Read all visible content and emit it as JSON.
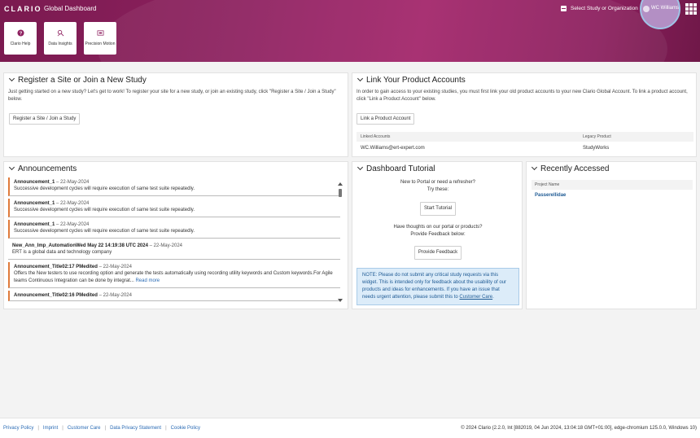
{
  "header": {
    "logo": "CLARIO",
    "title": "Global Dashboard",
    "study_select": "Select Study or Organization",
    "user_name": "WC Williams"
  },
  "tiles": [
    {
      "label": "Clario Help",
      "icon": "help-icon"
    },
    {
      "label": "Data Insights",
      "icon": "data-insights-icon"
    },
    {
      "label": "Precision Motion",
      "icon": "precision-motion-icon"
    }
  ],
  "register": {
    "title": "Register a Site or Join a New Study",
    "text": "Just getting started on a new study? Let's get to work! To register your site for a new study, or join an existing study, click \"Register a Site / Join a Study\" below.",
    "button": "Register a Site / Join a Study"
  },
  "link": {
    "title": "Link Your Product Accounts",
    "text": "In order to gain access to your existing studies, you must first link your old product accounts to your new Clario Global Account. To link a product account, click \"Link a Product Account\" below.",
    "button": "Link a Product Account",
    "col1": "Linked Accounts",
    "col2": "Legacy Product",
    "row_account": "WC.Williams@ert-expert.com",
    "row_product": "StudyWorks"
  },
  "announcements": {
    "title": "Announcements",
    "items": [
      {
        "title": "Announcement_1",
        "date": "22-May-2024",
        "body": "Successive development cycles will require execution of same test suite repeatedly."
      },
      {
        "title": "Announcement_1",
        "date": "22-May-2024",
        "body": "Successive development cycles will require execution of same test suite repeatedly."
      },
      {
        "title": "Announcement_1",
        "date": "22-May-2024",
        "body": "Successive development cycles will require execution of same test suite repeatedly."
      },
      {
        "title": "New_Ann_Imp_AutomationWed May 22 14:19:38 UTC 2024",
        "date": "22-May-2024",
        "body": "ERT is a global data and technology company"
      },
      {
        "title": "Announcement_Title02:17 PMedited",
        "date": "22-May-2024",
        "body": "Offers the New testers to use recording option and generate the tests automatically using recording utility keywords and Custom keywords.For Agile teams Continuous Integration can be done by integrat...",
        "more": "Read more"
      },
      {
        "title": "Announcement_Title02:16 PMedited",
        "date": "22-May-2024",
        "body": ""
      }
    ]
  },
  "tutorial": {
    "title": "Dashboard Tutorial",
    "line1": "New to Portal or need a refresher?",
    "line2": "Try these:",
    "start_button": "Start Tutorial",
    "line3": "Have thoughts on our portal or products?",
    "line4": "Provide Feedback below:",
    "feedback_button": "Provide Feedback",
    "note": "NOTE: Please do not submit any critical study requests via this widget. This is intended only for feedback about the usability of our products and ideas for enhancements. If you have an issue that needs urgent attention, please submit this to ",
    "note_link": "Customer Care",
    "note_end": "."
  },
  "recent": {
    "title": "Recently Accessed",
    "col": "Project Name",
    "item": "Passerellidae"
  },
  "footer": {
    "links": [
      "Privacy Policy",
      "Imprint",
      "Customer Care",
      "Data Privacy Statement",
      "Cookie Policy"
    ],
    "separator": "|",
    "copyright": "© 2024 Clario (2.2.0, lnt [882019, 04 Jun 2024, 13:04:18 GMT+01:00], edge-chromium 125.0.0, Windows 10)"
  },
  "colors": {
    "brand": "#8e2160",
    "accent_border": "#e07b3c",
    "link": "#2a6bb5"
  }
}
